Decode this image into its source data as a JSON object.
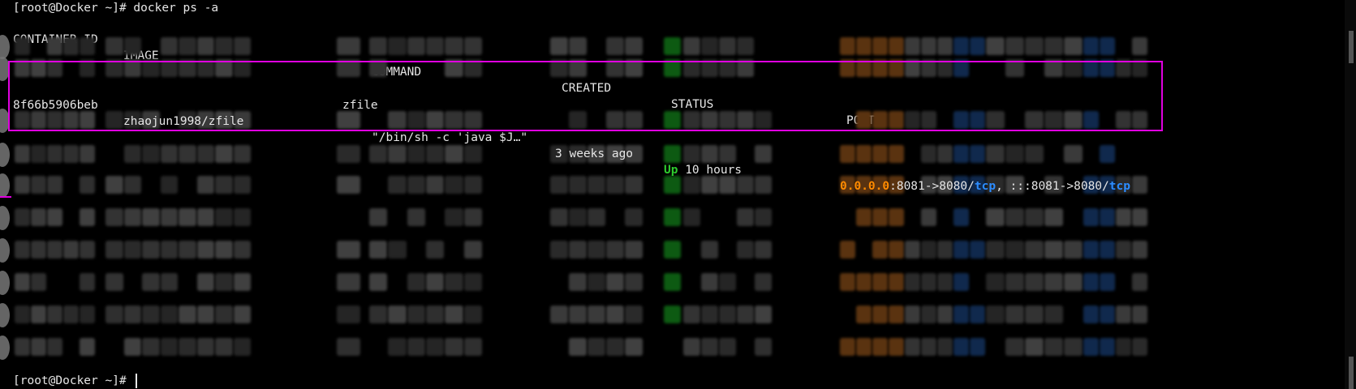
{
  "terminal": {
    "prompt_command": "[root@Docker ~]# docker ps -a",
    "final_prompt": "[root@Docker ~]# ",
    "header": {
      "container_id": "CONTAINER ID",
      "image": "IMAGE",
      "command": "COMMAND",
      "created": "CREATED",
      "status": "STATUS",
      "ports": "PORTS"
    },
    "highlighted_row": {
      "container_id": "8f66b5906beb",
      "image": "zhaojun1998/zfile",
      "command": "\"/bin/sh -c 'java $J…\"",
      "created": "3 weeks ago",
      "status_up": "Up",
      "status_rest": " 10 hours",
      "ports_ip": "0.0.0.0",
      "ports_part1": ":8081->8080/",
      "ports_proto1": "tcp",
      "ports_sep": ", :::8081->8080/",
      "ports_proto2": "tcp",
      "name": "zfile"
    },
    "colors": {
      "background": "#000000",
      "text": "#e6e6e6",
      "highlight_border": "#e000e0",
      "status_up": "#2ecc2e",
      "ip": "#ff8a00",
      "proto": "#2c8cff"
    }
  }
}
